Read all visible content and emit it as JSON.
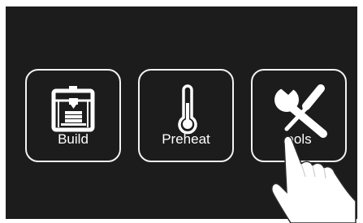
{
  "menu": {
    "tiles": [
      {
        "label": "Build",
        "icon": "3d-printer-icon"
      },
      {
        "label": "Preheat",
        "icon": "thermometer-icon"
      },
      {
        "label": "ools",
        "icon": "wrench-screwdriver-icon"
      }
    ]
  },
  "colors": {
    "background": "#1c1c1c",
    "foreground": "#ffffff"
  }
}
